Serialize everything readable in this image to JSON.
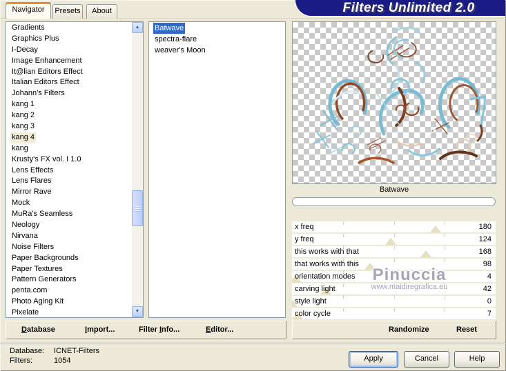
{
  "window": {
    "title": "Filters Unlimited 2.0"
  },
  "tabs": [
    {
      "label": "Navigator",
      "active": true
    },
    {
      "label": "Presets",
      "active": false
    },
    {
      "label": "About",
      "active": false
    }
  ],
  "categories": [
    "Gradients",
    "Graphics Plus",
    "I-Decay",
    "Image Enhancement",
    "It@lian Editors Effect",
    "Italian Editors Effect",
    "Johann's Filters",
    "kang 1",
    "kang 2",
    "kang 3",
    "kang 4",
    "kang",
    "Krusty's FX vol. I 1.0",
    "Lens Effects",
    "Lens Flares",
    "Mirror Rave",
    "Mock",
    "MuRa's Seamless",
    "Neology",
    "Nirvana",
    "Noise Filters",
    "Paper Backgrounds",
    "Paper Textures",
    "Pattern Generators",
    "penta.com",
    "Photo Aging Kit",
    "Pixelate"
  ],
  "highlighted_category": "kang 4",
  "filters": [
    "Batwave",
    "spectra-flare",
    "weaver's Moon"
  ],
  "selected_filter": "Batwave",
  "preview": {
    "caption": "Batwave",
    "progress_percent": 0,
    "watermark_line1": "Pinuccia",
    "watermark_line2": "www.maidiregrafica.eu"
  },
  "params": {
    "max": 255,
    "items": [
      {
        "label": "x freq",
        "value": 180
      },
      {
        "label": "y freq",
        "value": 124
      },
      {
        "label": "this works with that",
        "value": 168
      },
      {
        "label": "that works with this",
        "value": 98
      },
      {
        "label": "orientation modes",
        "value": 4
      },
      {
        "label": "carving light",
        "value": 42
      },
      {
        "label": "style light",
        "value": 0
      },
      {
        "label": "color cycle",
        "value": 7
      }
    ]
  },
  "toolbar": {
    "database": {
      "pre": "",
      "accel": "D",
      "post": "atabase"
    },
    "import": {
      "pre": "",
      "accel": "I",
      "post": "mport..."
    },
    "filter_info": {
      "pre": "Filter ",
      "accel": "I",
      "post": "nfo..."
    },
    "editor": {
      "pre": "",
      "accel": "E",
      "post": "ditor..."
    },
    "randomize": "Randomize",
    "reset": "Reset"
  },
  "status": {
    "database_label": "Database:",
    "database_value": "ICNET-Filters",
    "filters_label": "Filters:",
    "filters_value": "1054"
  },
  "footer": {
    "apply": "Apply",
    "cancel": "Cancel",
    "help": "Help"
  },
  "icons": {
    "scroll_up": "▲",
    "scroll_down": "▼"
  },
  "colors": {
    "selection_blue": "#316AC5",
    "banner_navy": "#1B1B86",
    "tab_accent_orange": "#E5912D",
    "slider_triangle": "#E7DFC2",
    "checker_gray": "#C9C9C9",
    "dialog_beige": "#ECE9D8"
  }
}
